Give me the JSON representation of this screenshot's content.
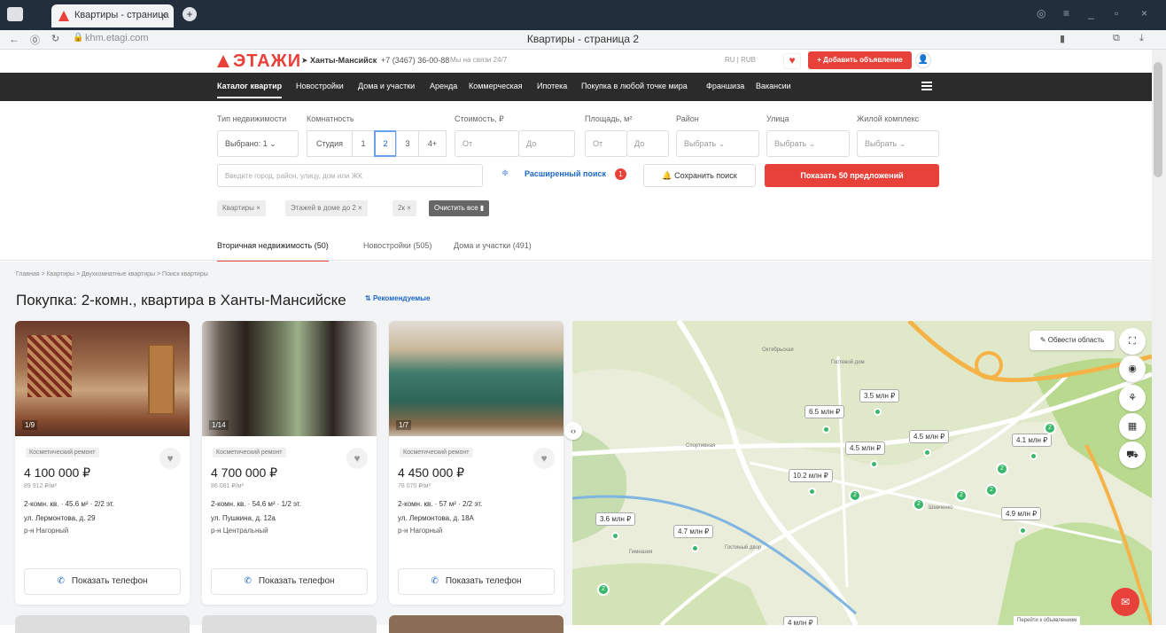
{
  "browser": {
    "tab_title": "Квартиры - страница",
    "address": "khm.etagi.com",
    "page_title": "Квартиры - страница 2"
  },
  "site": {
    "logo": "ЭТАЖИ",
    "city": "Ханты-Мансийск",
    "phone": "+7 (3467) 36-00-88",
    "worktime": "Мы на связи 24/7",
    "lang": "RU | RUB",
    "add_listing": "+ Добавить объявление"
  },
  "nav": [
    "Каталог квартир",
    "Новостройки",
    "Дома и участки",
    "Аренда",
    "Коммерческая",
    "Ипотека",
    "Покупка в любой точке мира",
    "Франшиза",
    "Вакансии"
  ],
  "filters": {
    "type_label": "Тип недвижимости",
    "type_value": "Выбрано: 1",
    "rooms_label": "Комнатность",
    "rooms": [
      "Студия",
      "1",
      "2",
      "3",
      "4+"
    ],
    "rooms_selected": "2",
    "price_label": "Стоимость, ₽",
    "from": "От",
    "to": "До",
    "area_label": "Площадь, м²",
    "district_label": "Район",
    "street_label": "Улица",
    "complex_label": "Жилой комплекс",
    "choose": "Выбрать",
    "search_placeholder": "Введите город, район, улицу, дом или ЖК",
    "advanced": "Расширенный поиск",
    "advanced_count": "1",
    "save_search": "Сохранить поиск",
    "show_offers": "Показать 50 предложений",
    "chips": [
      "Квартиры ×",
      "Этажей в доме до 2 ×",
      "2к ×"
    ],
    "clear_all": "Очистить все"
  },
  "tabs": [
    "Вторичная недвижимость (50)",
    "Новостройки (505)",
    "Дома и участки (491)"
  ],
  "breadcrumbs": "Главная  >  Квартиры  >  Двухкомнатные квартиры  >  Поиск квартиры",
  "heading": "Покупка: 2-комн., квартира в Ханты-Мансийске",
  "sort": "Рекомендуемые",
  "cards": [
    {
      "counter": "1/9",
      "tag": "Косметический ремонт",
      "price": "4 100 000 ₽",
      "ppm": "89 912 ₽/м²",
      "params": "2-комн. кв.  ·  45.6 м²  ·  2/2 эт.",
      "address": "ул. Лермонтова, д. 29",
      "district": "р-н Нагорный",
      "phone": "Показать телефон"
    },
    {
      "counter": "1/14",
      "tag": "Косметический ремонт",
      "price": "4 700 000 ₽",
      "ppm": "86 081 ₽/м²",
      "params": "2-комн. кв.  ·  54.6 м²  ·  1/2 эт.",
      "address": "ул. Пушкина, д. 12а",
      "district": "р-н Центральный",
      "phone": "Показать телефон"
    },
    {
      "counter": "1/7",
      "tag": "Косметический ремонт",
      "price": "4 450 000 ₽",
      "ppm": "78 070 ₽/м²",
      "params": "2-комн. кв.  ·  57 м²  ·  2/2 эт.",
      "address": "ул. Лермонтова, д. 18А",
      "district": "р-н Нагорный",
      "phone": "Показать телефон"
    }
  ],
  "map": {
    "outline_area": "Обвести область",
    "prices": [
      "3.5 млн ₽",
      "6.5 млн ₽",
      "4.5 млн ₽",
      "4.5 млн ₽",
      "4.1 млн ₽",
      "10.2 млн ₽",
      "3.6 млн ₽",
      "4.7 млн ₽",
      "4.9 млн ₽",
      "4 млн ₽"
    ],
    "clusters": [
      "2",
      "2",
      "2",
      "2",
      "2",
      "2",
      "2"
    ],
    "labels": [
      "Октябрьская",
      "Гостевой дом",
      "Гостиный двор",
      "Гимназия",
      "Шевченко",
      "Спортивная"
    ],
    "collect": "Перейти к объявлениям"
  },
  "colors": {
    "accent": "#e8413a",
    "link": "#1a66c9",
    "nav_bg": "#2b2b2b",
    "map_marker": "#3ab86a"
  }
}
